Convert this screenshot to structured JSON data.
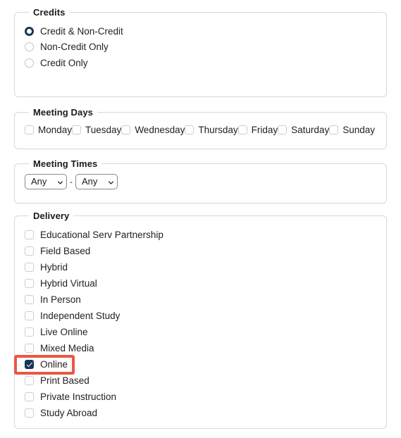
{
  "credits": {
    "title": "Credits",
    "options": [
      {
        "label": "Credit & Non-Credit",
        "checked": true
      },
      {
        "label": "Non-Credit Only",
        "checked": false
      },
      {
        "label": "Credit Only",
        "checked": false
      }
    ]
  },
  "meeting_days": {
    "title": "Meeting Days",
    "days": [
      {
        "label": "Monday",
        "checked": false
      },
      {
        "label": "Tuesday",
        "checked": false
      },
      {
        "label": "Wednesday",
        "checked": false
      },
      {
        "label": "Thursday",
        "checked": false
      },
      {
        "label": "Friday",
        "checked": false
      },
      {
        "label": "Saturday",
        "checked": false
      },
      {
        "label": "Sunday",
        "checked": false
      }
    ]
  },
  "meeting_times": {
    "title": "Meeting Times",
    "separator": "-",
    "start": {
      "value": "Any",
      "options": [
        "Any"
      ]
    },
    "end": {
      "value": "Any",
      "options": [
        "Any"
      ]
    }
  },
  "delivery": {
    "title": "Delivery",
    "options": [
      {
        "label": "Educational Serv Partnership",
        "checked": false
      },
      {
        "label": "Field Based",
        "checked": false
      },
      {
        "label": "Hybrid",
        "checked": false
      },
      {
        "label": "Hybrid Virtual",
        "checked": false
      },
      {
        "label": "In Person",
        "checked": false
      },
      {
        "label": "Independent Study",
        "checked": false
      },
      {
        "label": "Live Online",
        "checked": false
      },
      {
        "label": "Mixed Media",
        "checked": false
      },
      {
        "label": "Online",
        "checked": true
      },
      {
        "label": "Print Based",
        "checked": false
      },
      {
        "label": "Private Instruction",
        "checked": false
      },
      {
        "label": "Study Abroad",
        "checked": false
      }
    ]
  },
  "annotation": {
    "target_label": "Online",
    "highlight_color": "#ea5844"
  },
  "theme": {
    "accent": "#17365c",
    "border": "#d8d8d8",
    "text": "#1a1a1a"
  }
}
